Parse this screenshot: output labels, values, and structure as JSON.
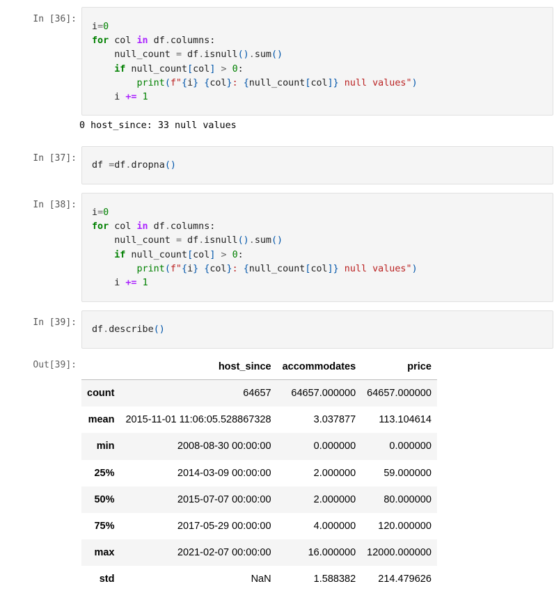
{
  "cells": [
    {
      "prompt": "In [36]:",
      "code_lines": [
        "i=0",
        "for col in df.columns:",
        "    null_count = df.isnull().sum()",
        "    if null_count[col] > 0:",
        "        print(f\"{i} {col}: {null_count[col]} null values\")",
        "    i += 1"
      ],
      "output": "0 host_since: 33 null values"
    },
    {
      "prompt": "In [37]:",
      "code_lines": [
        "df =df.dropna()"
      ]
    },
    {
      "prompt": "In [38]:",
      "code_lines": [
        "i=0",
        "for col in df.columns:",
        "    null_count = df.isnull().sum()",
        "    if null_count[col] > 0:",
        "        print(f\"{i} {col}: {null_count[col]} null values\")",
        "    i += 1"
      ]
    },
    {
      "prompt": "In [39]:",
      "code_lines": [
        "df.describe()"
      ],
      "out_prompt": "Out[39]:"
    }
  ],
  "table": {
    "columns": [
      "",
      "host_since",
      "accommodates",
      "price"
    ],
    "rows": [
      {
        "index": "count",
        "values": [
          "64657",
          "64657.000000",
          "64657.000000"
        ]
      },
      {
        "index": "mean",
        "values": [
          "2015-11-01 11:06:05.528867328",
          "3.037877",
          "113.104614"
        ]
      },
      {
        "index": "min",
        "values": [
          "2008-08-30 00:00:00",
          "0.000000",
          "0.000000"
        ]
      },
      {
        "index": "25%",
        "values": [
          "2014-03-09 00:00:00",
          "2.000000",
          "59.000000"
        ]
      },
      {
        "index": "50%",
        "values": [
          "2015-07-07 00:00:00",
          "2.000000",
          "80.000000"
        ]
      },
      {
        "index": "75%",
        "values": [
          "2017-05-29 00:00:00",
          "4.000000",
          "120.000000"
        ]
      },
      {
        "index": "max",
        "values": [
          "2021-02-07 00:00:00",
          "16.000000",
          "12000.000000"
        ]
      },
      {
        "index": "std",
        "values": [
          "NaN",
          "1.588382",
          "214.479626"
        ]
      }
    ]
  }
}
